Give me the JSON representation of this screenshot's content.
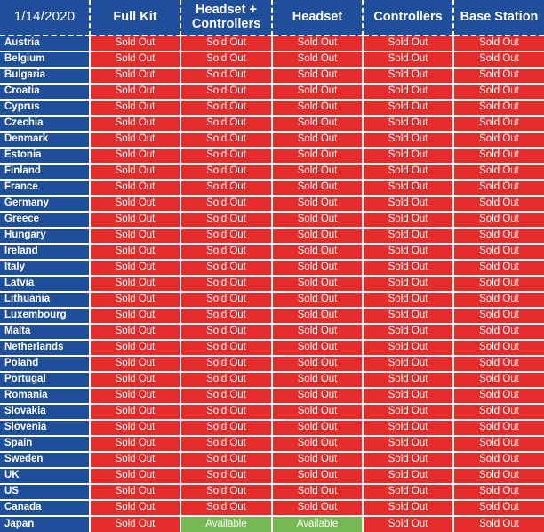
{
  "table": {
    "header": {
      "date_label": "1/14/2020",
      "columns": [
        "Full Kit",
        "Headset + Controllers",
        "Headset",
        "Controllers",
        "Base Station"
      ]
    },
    "status_labels": {
      "sold_out": "Sold Out",
      "available": "Available"
    },
    "colors": {
      "header_blue": "#1f4e9b",
      "row_label_blue": "#1f4e9b",
      "sold_out_red": "#e62b2b",
      "available_green": "#76b852",
      "grid_line": "#ffffff",
      "text": "#ffffff"
    },
    "rows": [
      {
        "country": "Austria",
        "cells": [
          "Sold Out",
          "Sold Out",
          "Sold Out",
          "Sold Out",
          "Sold Out"
        ]
      },
      {
        "country": "Belgium",
        "cells": [
          "Sold Out",
          "Sold Out",
          "Sold Out",
          "Sold Out",
          "Sold Out"
        ]
      },
      {
        "country": "Bulgaria",
        "cells": [
          "Sold Out",
          "Sold Out",
          "Sold Out",
          "Sold Out",
          "Sold Out"
        ]
      },
      {
        "country": "Croatia",
        "cells": [
          "Sold Out",
          "Sold Out",
          "Sold Out",
          "Sold Out",
          "Sold Out"
        ]
      },
      {
        "country": "Cyprus",
        "cells": [
          "Sold Out",
          "Sold Out",
          "Sold Out",
          "Sold Out",
          "Sold Out"
        ]
      },
      {
        "country": "Czechia",
        "cells": [
          "Sold Out",
          "Sold Out",
          "Sold Out",
          "Sold Out",
          "Sold Out"
        ]
      },
      {
        "country": "Denmark",
        "cells": [
          "Sold Out",
          "Sold Out",
          "Sold Out",
          "Sold Out",
          "Sold Out"
        ]
      },
      {
        "country": "Estonia",
        "cells": [
          "Sold Out",
          "Sold Out",
          "Sold Out",
          "Sold Out",
          "Sold Out"
        ]
      },
      {
        "country": "Finland",
        "cells": [
          "Sold Out",
          "Sold Out",
          "Sold Out",
          "Sold Out",
          "Sold Out"
        ]
      },
      {
        "country": "France",
        "cells": [
          "Sold Out",
          "Sold Out",
          "Sold Out",
          "Sold Out",
          "Sold Out"
        ]
      },
      {
        "country": "Germany",
        "cells": [
          "Sold Out",
          "Sold Out",
          "Sold Out",
          "Sold Out",
          "Sold Out"
        ]
      },
      {
        "country": "Greece",
        "cells": [
          "Sold Out",
          "Sold Out",
          "Sold Out",
          "Sold Out",
          "Sold Out"
        ]
      },
      {
        "country": "Hungary",
        "cells": [
          "Sold Out",
          "Sold Out",
          "Sold Out",
          "Sold Out",
          "Sold Out"
        ]
      },
      {
        "country": "Ireland",
        "cells": [
          "Sold Out",
          "Sold Out",
          "Sold Out",
          "Sold Out",
          "Sold Out"
        ]
      },
      {
        "country": "Italy",
        "cells": [
          "Sold Out",
          "Sold Out",
          "Sold Out",
          "Sold Out",
          "Sold Out"
        ]
      },
      {
        "country": "Latvia",
        "cells": [
          "Sold Out",
          "Sold Out",
          "Sold Out",
          "Sold Out",
          "Sold Out"
        ]
      },
      {
        "country": "Lithuania",
        "cells": [
          "Sold Out",
          "Sold Out",
          "Sold Out",
          "Sold Out",
          "Sold Out"
        ]
      },
      {
        "country": "Luxembourg",
        "cells": [
          "Sold Out",
          "Sold Out",
          "Sold Out",
          "Sold Out",
          "Sold Out"
        ]
      },
      {
        "country": "Malta",
        "cells": [
          "Sold Out",
          "Sold Out",
          "Sold Out",
          "Sold Out",
          "Sold Out"
        ]
      },
      {
        "country": "Netherlands",
        "cells": [
          "Sold Out",
          "Sold Out",
          "Sold Out",
          "Sold Out",
          "Sold Out"
        ]
      },
      {
        "country": "Poland",
        "cells": [
          "Sold Out",
          "Sold Out",
          "Sold Out",
          "Sold Out",
          "Sold Out"
        ]
      },
      {
        "country": "Portugal",
        "cells": [
          "Sold Out",
          "Sold Out",
          "Sold Out",
          "Sold Out",
          "Sold Out"
        ]
      },
      {
        "country": "Romania",
        "cells": [
          "Sold Out",
          "Sold Out",
          "Sold Out",
          "Sold Out",
          "Sold Out"
        ]
      },
      {
        "country": "Slovakia",
        "cells": [
          "Sold Out",
          "Sold Out",
          "Sold Out",
          "Sold Out",
          "Sold Out"
        ]
      },
      {
        "country": "Slovenia",
        "cells": [
          "Sold Out",
          "Sold Out",
          "Sold Out",
          "Sold Out",
          "Sold Out"
        ]
      },
      {
        "country": "Spain",
        "cells": [
          "Sold Out",
          "Sold Out",
          "Sold Out",
          "Sold Out",
          "Sold Out"
        ]
      },
      {
        "country": "Sweden",
        "cells": [
          "Sold Out",
          "Sold Out",
          "Sold Out",
          "Sold Out",
          "Sold Out"
        ]
      },
      {
        "country": "UK",
        "cells": [
          "Sold Out",
          "Sold Out",
          "Sold Out",
          "Sold Out",
          "Sold Out"
        ]
      },
      {
        "country": "US",
        "cells": [
          "Sold Out",
          "Sold Out",
          "Sold Out",
          "Sold Out",
          "Sold Out"
        ]
      },
      {
        "country": "Canada",
        "cells": [
          "Sold Out",
          "Sold Out",
          "Sold Out",
          "Sold Out",
          "Sold Out"
        ]
      },
      {
        "country": "Japan",
        "cells": [
          "Sold Out",
          "Available",
          "Available",
          "Sold Out",
          "Sold Out"
        ]
      }
    ]
  },
  "chart_data": {
    "type": "table",
    "title": "1/14/2020",
    "columns": [
      "1/14/2020",
      "Full Kit",
      "Headset + Controllers",
      "Headset",
      "Controllers",
      "Base Station"
    ],
    "categories": [
      "Austria",
      "Belgium",
      "Bulgaria",
      "Croatia",
      "Cyprus",
      "Czechia",
      "Denmark",
      "Estonia",
      "Finland",
      "France",
      "Germany",
      "Greece",
      "Hungary",
      "Ireland",
      "Italy",
      "Latvia",
      "Lithuania",
      "Luxembourg",
      "Malta",
      "Netherlands",
      "Poland",
      "Portugal",
      "Romania",
      "Slovakia",
      "Slovenia",
      "Spain",
      "Sweden",
      "UK",
      "US",
      "Canada",
      "Japan"
    ],
    "series": [
      {
        "name": "Full Kit",
        "values": [
          "Sold Out",
          "Sold Out",
          "Sold Out",
          "Sold Out",
          "Sold Out",
          "Sold Out",
          "Sold Out",
          "Sold Out",
          "Sold Out",
          "Sold Out",
          "Sold Out",
          "Sold Out",
          "Sold Out",
          "Sold Out",
          "Sold Out",
          "Sold Out",
          "Sold Out",
          "Sold Out",
          "Sold Out",
          "Sold Out",
          "Sold Out",
          "Sold Out",
          "Sold Out",
          "Sold Out",
          "Sold Out",
          "Sold Out",
          "Sold Out",
          "Sold Out",
          "Sold Out",
          "Sold Out",
          "Sold Out"
        ]
      },
      {
        "name": "Headset + Controllers",
        "values": [
          "Sold Out",
          "Sold Out",
          "Sold Out",
          "Sold Out",
          "Sold Out",
          "Sold Out",
          "Sold Out",
          "Sold Out",
          "Sold Out",
          "Sold Out",
          "Sold Out",
          "Sold Out",
          "Sold Out",
          "Sold Out",
          "Sold Out",
          "Sold Out",
          "Sold Out",
          "Sold Out",
          "Sold Out",
          "Sold Out",
          "Sold Out",
          "Sold Out",
          "Sold Out",
          "Sold Out",
          "Sold Out",
          "Sold Out",
          "Sold Out",
          "Sold Out",
          "Sold Out",
          "Sold Out",
          "Available"
        ]
      },
      {
        "name": "Headset",
        "values": [
          "Sold Out",
          "Sold Out",
          "Sold Out",
          "Sold Out",
          "Sold Out",
          "Sold Out",
          "Sold Out",
          "Sold Out",
          "Sold Out",
          "Sold Out",
          "Sold Out",
          "Sold Out",
          "Sold Out",
          "Sold Out",
          "Sold Out",
          "Sold Out",
          "Sold Out",
          "Sold Out",
          "Sold Out",
          "Sold Out",
          "Sold Out",
          "Sold Out",
          "Sold Out",
          "Sold Out",
          "Sold Out",
          "Sold Out",
          "Sold Out",
          "Sold Out",
          "Sold Out",
          "Sold Out",
          "Available"
        ]
      },
      {
        "name": "Controllers",
        "values": [
          "Sold Out",
          "Sold Out",
          "Sold Out",
          "Sold Out",
          "Sold Out",
          "Sold Out",
          "Sold Out",
          "Sold Out",
          "Sold Out",
          "Sold Out",
          "Sold Out",
          "Sold Out",
          "Sold Out",
          "Sold Out",
          "Sold Out",
          "Sold Out",
          "Sold Out",
          "Sold Out",
          "Sold Out",
          "Sold Out",
          "Sold Out",
          "Sold Out",
          "Sold Out",
          "Sold Out",
          "Sold Out",
          "Sold Out",
          "Sold Out",
          "Sold Out",
          "Sold Out",
          "Sold Out",
          "Sold Out"
        ]
      },
      {
        "name": "Base Station",
        "values": [
          "Sold Out",
          "Sold Out",
          "Sold Out",
          "Sold Out",
          "Sold Out",
          "Sold Out",
          "Sold Out",
          "Sold Out",
          "Sold Out",
          "Sold Out",
          "Sold Out",
          "Sold Out",
          "Sold Out",
          "Sold Out",
          "Sold Out",
          "Sold Out",
          "Sold Out",
          "Sold Out",
          "Sold Out",
          "Sold Out",
          "Sold Out",
          "Sold Out",
          "Sold Out",
          "Sold Out",
          "Sold Out",
          "Sold Out",
          "Sold Out",
          "Sold Out",
          "Sold Out",
          "Sold Out",
          "Sold Out"
        ]
      }
    ],
    "legend": {
      "Sold Out": "#e62b2b",
      "Available": "#76b852"
    },
    "xlabel": "",
    "ylabel": ""
  }
}
